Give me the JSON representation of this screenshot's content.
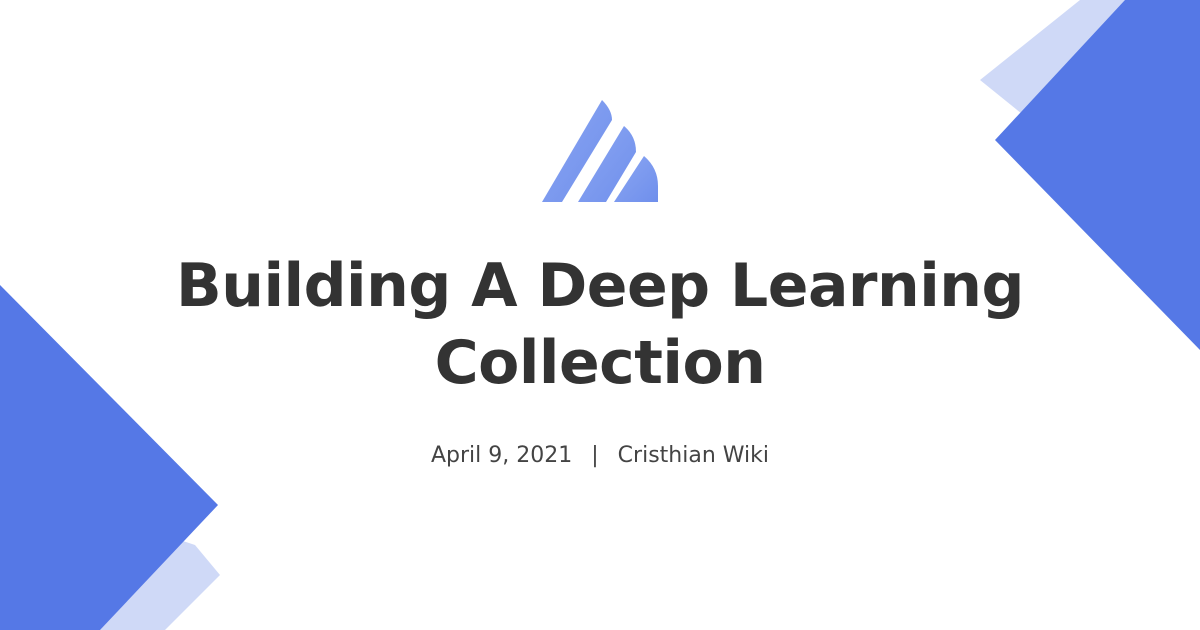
{
  "title": {
    "line1": "Building A Deep Learning",
    "line2": "Collection"
  },
  "meta": {
    "date": "April 9, 2021",
    "separator": "|",
    "author": "Cristhian Wiki"
  },
  "logo": {
    "icon": "layered-peak-logo"
  },
  "colors": {
    "background": "#ffffff",
    "accent": "#5578e6",
    "accent_light": "#cfd9f7",
    "logo": "#7d9bef",
    "title": "#333333",
    "meta": "#444444"
  }
}
